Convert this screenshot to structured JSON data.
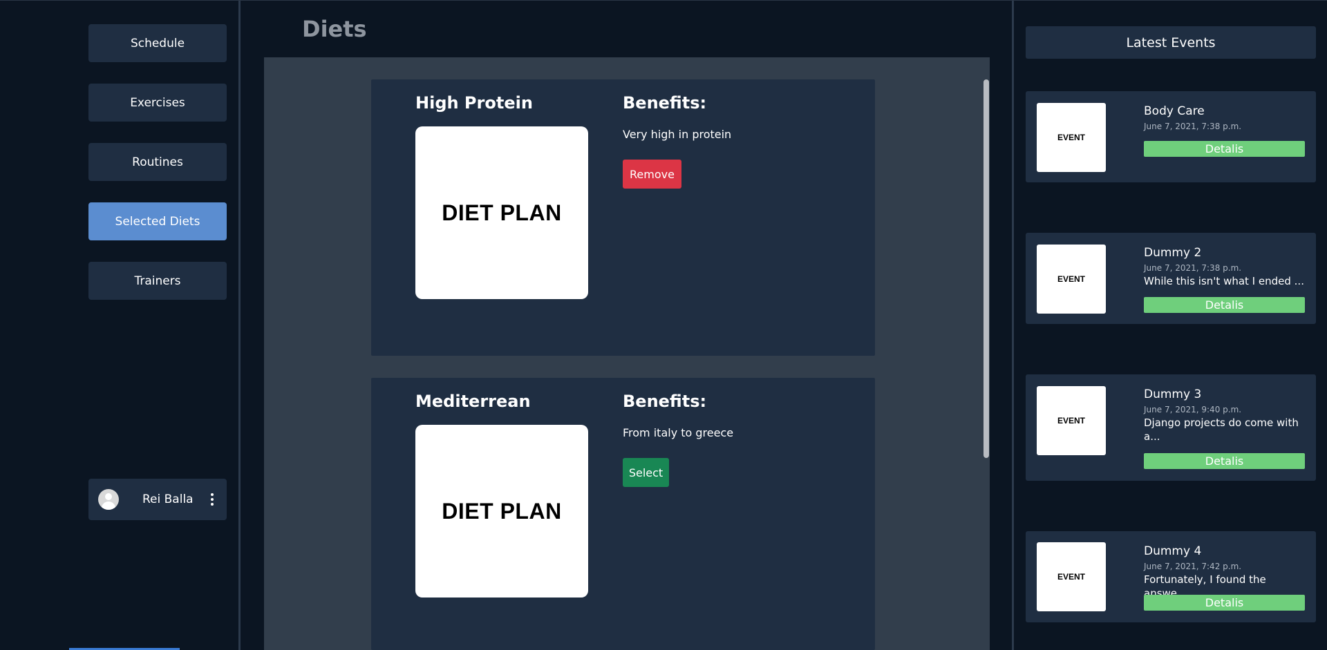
{
  "sidebar": {
    "nav": [
      {
        "label": "Schedule",
        "active": false
      },
      {
        "label": "Exercises",
        "active": false
      },
      {
        "label": "Routines",
        "active": false
      },
      {
        "label": "Selected Diets",
        "active": true
      },
      {
        "label": "Trainers",
        "active": false
      }
    ],
    "user": {
      "name": "Rei Balla",
      "avatar_icon": "user-avatar-icon",
      "menu_icon": "kebab-menu-icon"
    }
  },
  "main": {
    "title": "Diets",
    "diets": [
      {
        "name": "High Protein",
        "image_text": "DIET PLAN",
        "benefits_title": "Benefits:",
        "benefits": "Very high in protein",
        "action": "Remove"
      },
      {
        "name": "Mediterrean",
        "image_text": "DIET PLAN",
        "benefits_title": "Benefits:",
        "benefits": "From italy to greece",
        "action": "Select"
      }
    ]
  },
  "events": {
    "header": "Latest Events",
    "items": [
      {
        "thumb_text": "EVENT",
        "title": "Body Care",
        "date": "June 7, 2021, 7:38 p.m.",
        "desc": "",
        "button": "Detalis"
      },
      {
        "thumb_text": "EVENT",
        "title": "Dummy 2",
        "date": "June 7, 2021, 7:38 p.m.",
        "desc": "While this isn't what I ended ...",
        "button": "Detalis"
      },
      {
        "thumb_text": "EVENT",
        "title": "Dummy 3",
        "date": "June 7, 2021, 9:40 p.m.",
        "desc": "Django projects do come with a...",
        "button": "Detalis"
      },
      {
        "thumb_text": "EVENT",
        "title": "Dummy 4",
        "date": "June 7, 2021, 7:42 p.m.",
        "desc": "Fortunately, I found the answe...",
        "button": "Detalis"
      }
    ]
  },
  "colors": {
    "background": "#0b1522",
    "card": "#1f2e42",
    "active_nav": "#5b8dd0",
    "remove_button": "#dc3545",
    "select_button": "#198754",
    "details_button": "#6fcf7c"
  }
}
